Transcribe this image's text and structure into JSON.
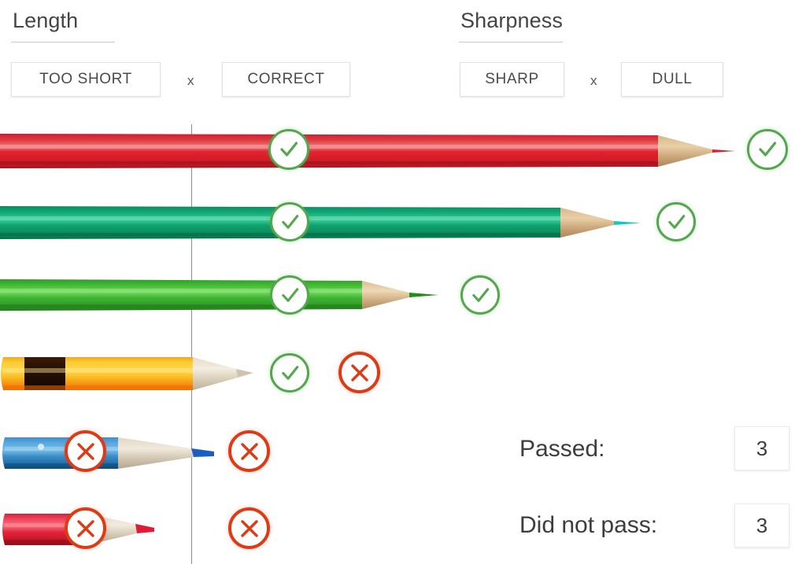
{
  "criteria": [
    {
      "id": "length",
      "title": "Length",
      "options": [
        {
          "label": "TOO SHORT"
        },
        {
          "label": "CORRECT"
        }
      ],
      "separator": "x"
    },
    {
      "id": "sharpness",
      "title": "Sharpness",
      "options": [
        {
          "label": "SHARP"
        },
        {
          "label": "DULL"
        }
      ],
      "separator": "x"
    }
  ],
  "colors": {
    "pass": "#53a74d",
    "fail": "#dd3a15",
    "divider": "#8c8c8c",
    "text": "#3d3d3d"
  },
  "icons": {
    "pass": "check-circle-icon",
    "fail": "x-circle-icon"
  },
  "rows": [
    {
      "index": 1,
      "pencil_color": "#d31f2b",
      "length_result": "pass",
      "sharpness_result": "pass"
    },
    {
      "index": 2,
      "pencil_color": "#0f9c6e",
      "length_result": "pass",
      "sharpness_result": "pass"
    },
    {
      "index": 3,
      "pencil_color": "#3cb030",
      "length_result": "pass",
      "sharpness_result": "pass"
    },
    {
      "index": 4,
      "pencil_color": "#f6b51e",
      "length_result": "pass",
      "sharpness_result": "fail"
    },
    {
      "index": 5,
      "pencil_color": "#2f7fc1",
      "length_result": "fail",
      "sharpness_result": "fail"
    },
    {
      "index": 6,
      "pencil_color": "#e02a3c",
      "length_result": "fail",
      "sharpness_result": "fail"
    }
  ],
  "summary": {
    "passed_label": "Passed:",
    "passed_count": "3",
    "failed_label": "Did not pass:",
    "failed_count": "3"
  }
}
